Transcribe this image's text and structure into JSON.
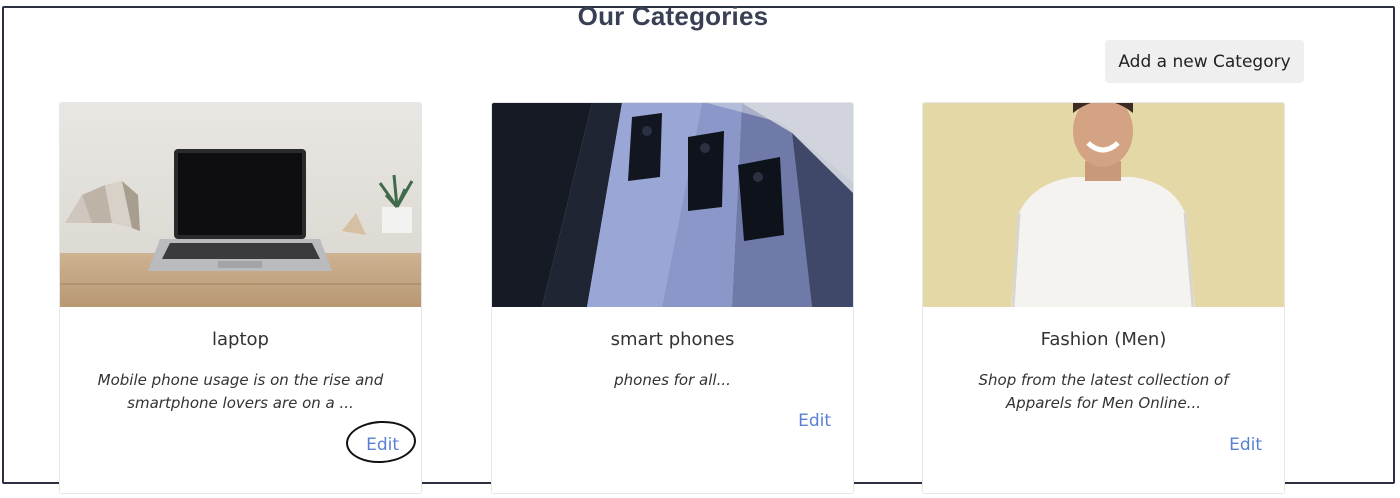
{
  "page": {
    "title": "Our Categories",
    "add_button_label": "Add a new Category"
  },
  "categories": [
    {
      "name": "laptop",
      "description": "Mobile phone usage is on the rise and smartphone lovers are on a ...",
      "edit_label": "Edit",
      "image": "laptop-on-desk-photo",
      "highlighted": true
    },
    {
      "name": "smart phones",
      "description": "phones for all...",
      "edit_label": "Edit",
      "image": "smartphones-backside-photo",
      "highlighted": false
    },
    {
      "name": "Fashion (Men)",
      "description": "Shop from the latest collection of Apparels for Men Online...",
      "edit_label": "Edit",
      "image": "man-in-white-sweater-photo",
      "highlighted": false
    }
  ],
  "colors": {
    "link": "#5a80d6",
    "title": "#3a4054",
    "button_bg": "#efefef",
    "frame_border": "#2b3142"
  }
}
